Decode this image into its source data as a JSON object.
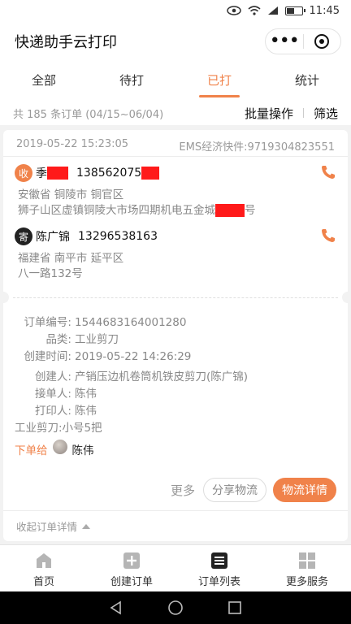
{
  "statusbar": {
    "time": "11:45",
    "icons": [
      "eye-icon",
      "wifi-icon",
      "signal-icon",
      "battery-icon"
    ],
    "battery_level": 0.45
  },
  "titlebar": {
    "title": "快递助手云打印",
    "more_icon": "more-dots-icon",
    "close_icon": "target-icon"
  },
  "tabs": [
    {
      "label": "全部",
      "active": false
    },
    {
      "label": "待打",
      "active": false
    },
    {
      "label": "已打",
      "active": true
    },
    {
      "label": "统计",
      "active": false
    }
  ],
  "summary": {
    "count_text": "共 185 条订单 (04/15~06/04)",
    "bulk_label": "批量操作",
    "filter_label": "筛选"
  },
  "order": {
    "datetime": "2019-05-22 15:23:05",
    "tracking": "EMS经济快件:9719304823551",
    "receiver": {
      "badge": "收",
      "name": "季",
      "phone": "138562075",
      "address_line1": "安徽省 铜陵市 铜官区",
      "address_line2a": "狮子山区虚镇铜陵大市场四期机电五金城",
      "address_line2b": "号"
    },
    "sender": {
      "badge": "寄",
      "name": "陈广锦",
      "phone": "13296538163",
      "address_line1": "福建省 南平市 延平区",
      "address_line2": "八一路132号"
    },
    "details": [
      {
        "label": "订单编号:",
        "value": "1544683164001280"
      },
      {
        "label": "品类:",
        "value": "工业剪刀"
      },
      {
        "label": "创建时间:",
        "value": "2019-05-22 14:26:29"
      },
      {
        "label": "创建人:",
        "value": "产销压边机卷筒机铁皮剪刀(陈广锦)"
      },
      {
        "label": "接单人:",
        "value": "陈伟"
      },
      {
        "label": "打印人:",
        "value": "陈伟"
      }
    ],
    "item_note": "工业剪刀:小号5把",
    "order_to_label": "下单给",
    "order_to_name": "陈伟",
    "more_label": "更多",
    "share_label": "分享物流",
    "detail_label": "物流详情",
    "collapse_label": "收起订单详情"
  },
  "bottomnav": [
    {
      "label": "首页",
      "icon": "home-icon"
    },
    {
      "label": "创建订单",
      "icon": "add-order-icon"
    },
    {
      "label": "订单列表",
      "icon": "order-list-icon"
    },
    {
      "label": "更多服务",
      "icon": "more-services-icon"
    }
  ],
  "colors": {
    "accent": "#f0824a",
    "redaction": "#ff1a1a"
  }
}
